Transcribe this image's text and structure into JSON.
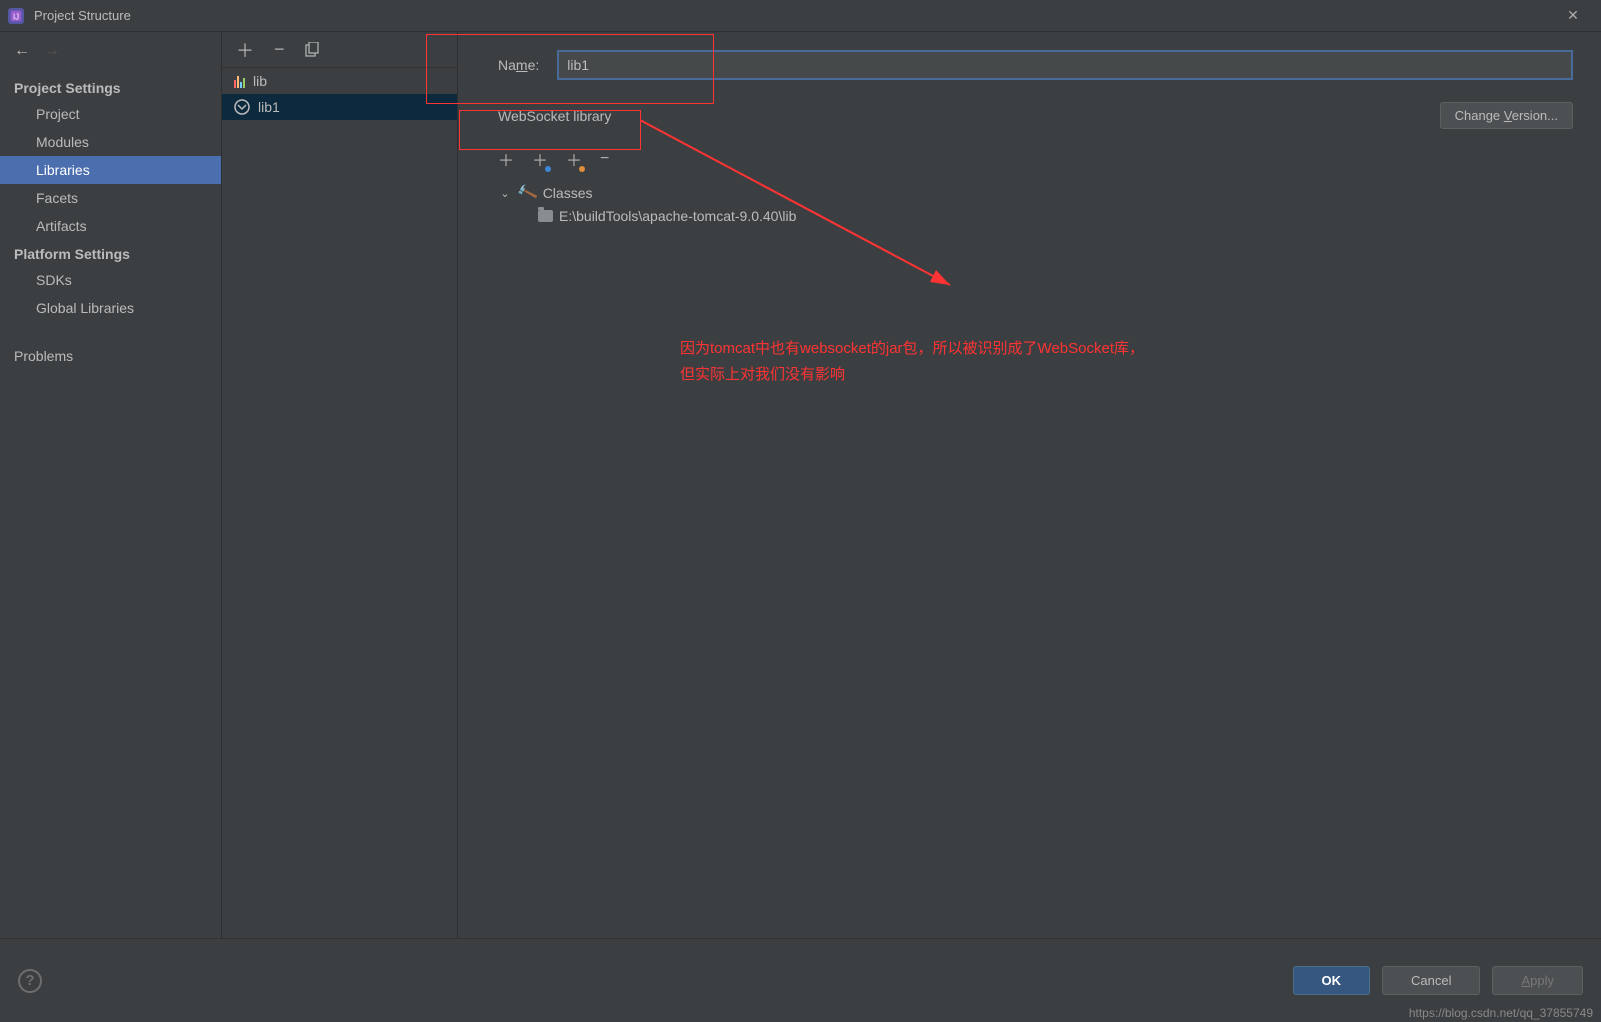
{
  "window": {
    "title": "Project Structure"
  },
  "sidebar": {
    "sections": [
      {
        "title": "Project Settings",
        "items": [
          "Project",
          "Modules",
          "Libraries",
          "Facets",
          "Artifacts"
        ],
        "selected": 2
      },
      {
        "title": "Platform Settings",
        "items": [
          "SDKs",
          "Global Libraries"
        ]
      },
      {
        "title": "",
        "items": [
          "Problems"
        ]
      }
    ]
  },
  "middle": {
    "items": [
      {
        "label": "lib",
        "icon": "bars",
        "selected": false
      },
      {
        "label": "lib1",
        "icon": "ws",
        "selected": true
      }
    ]
  },
  "main": {
    "name_label_pre": "Na",
    "name_label_u": "m",
    "name_label_post": "e:",
    "name_value": "lib1",
    "library_type": "WebSocket library",
    "change_btn_pre": "Change ",
    "change_btn_u": "V",
    "change_btn_post": "ersion...",
    "tree": {
      "root": {
        "label": "Classes"
      },
      "child": {
        "label": "E:\\buildTools\\apache-tomcat-9.0.40\\lib"
      }
    }
  },
  "annotation": {
    "line1": "因为tomcat中也有websocket的jar包，所以被识别成了WebSocket库，",
    "line2": "但实际上对我们没有影响"
  },
  "footer": {
    "ok": "OK",
    "cancel": "Cancel",
    "apply_pre": "",
    "apply_u": "A",
    "apply_post": "pply"
  },
  "watermark": "https://blog.csdn.net/qq_37855749"
}
